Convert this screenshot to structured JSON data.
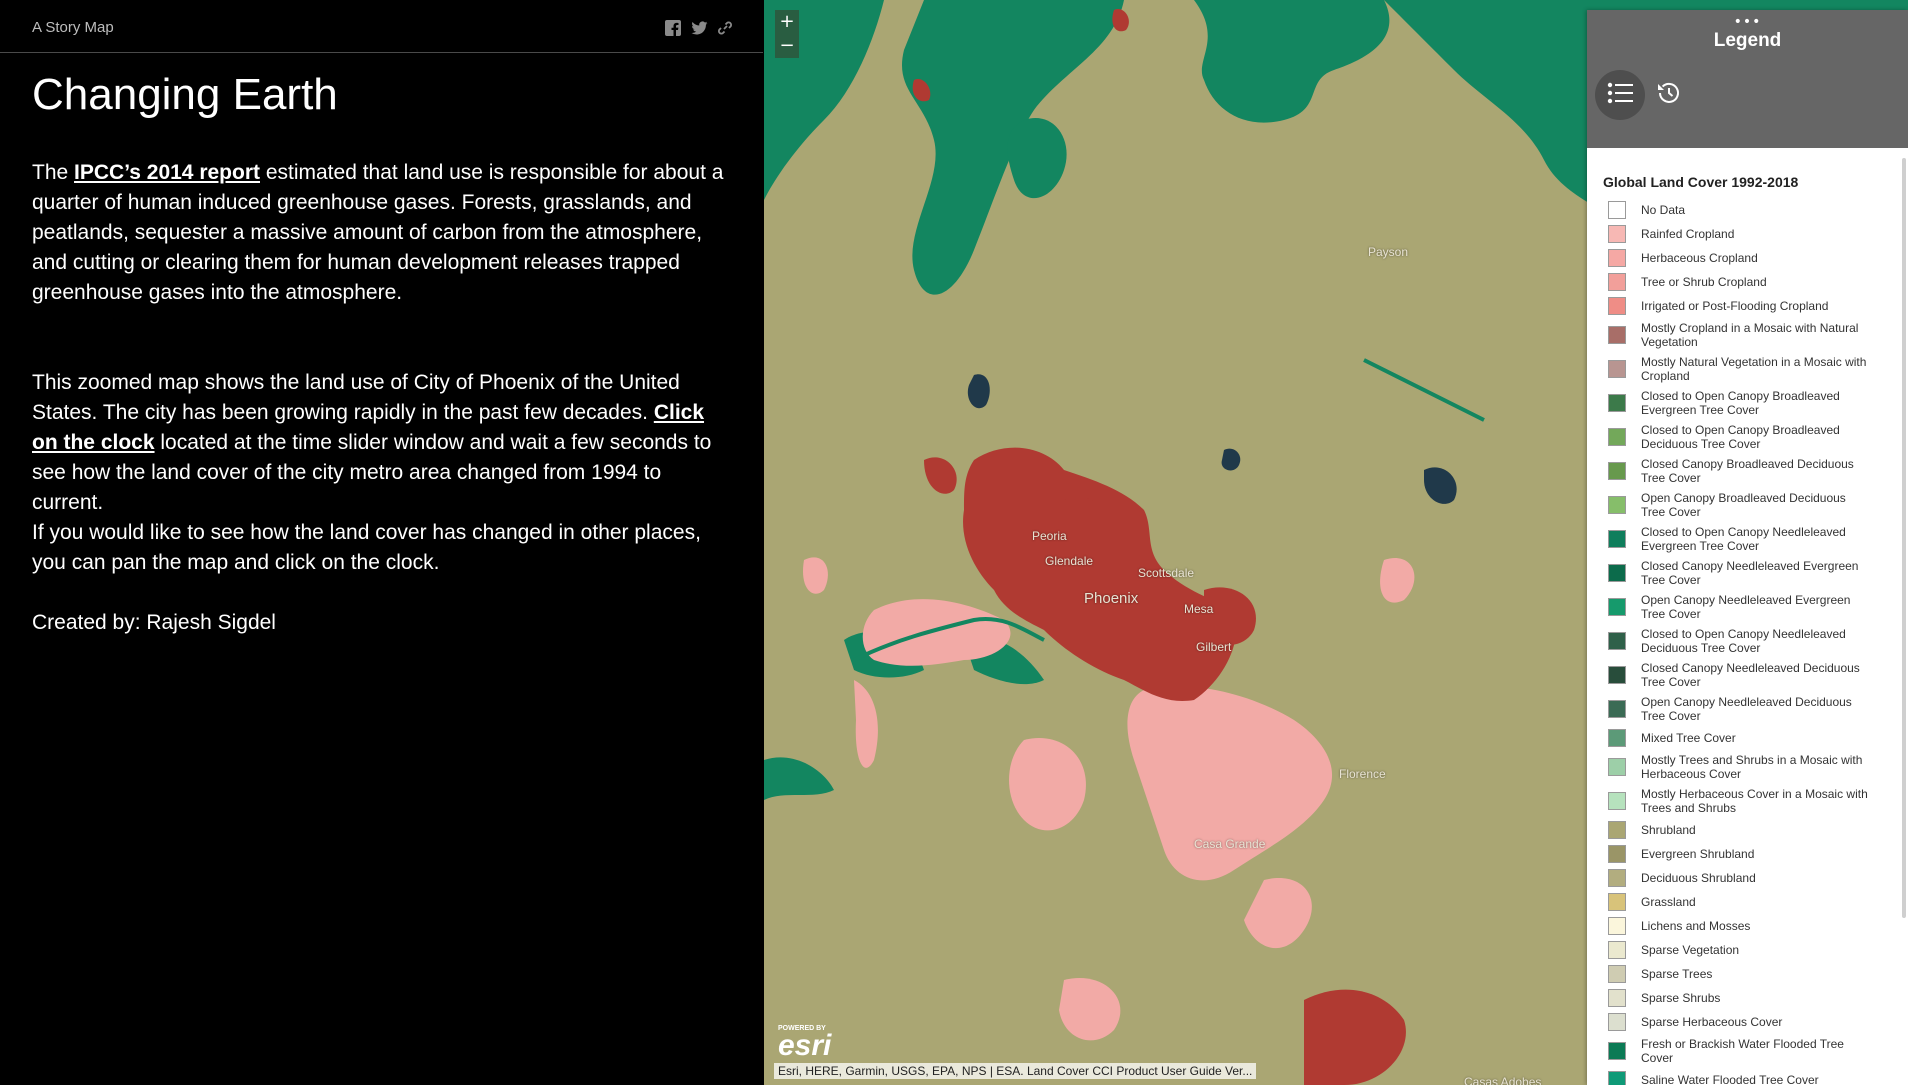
{
  "header": {
    "brand": "A Story Map"
  },
  "share": {
    "icons": [
      "facebook-icon",
      "twitter-icon",
      "link-icon"
    ]
  },
  "story": {
    "title": "Changing Earth",
    "p1_before": "The ",
    "p1_link": "IPCC’s 2014 report",
    "p1_after": " estimated that land use is responsible for about a quarter of human induced greenhouse gases. Forests, grasslands, and peatlands, sequester a massive amount of carbon from the atmosphere, and cutting or clearing them for human development releases trapped greenhouse gases into the atmosphere.",
    "p2_before": "This zoomed map shows the land use of City of Phoenix of the United States. The city has been growing rapidly in the past few decades. ",
    "p2_link": "Click on the clock",
    "p2_after": " located at the time slider window and wait a few seconds to see how the land cover of the city metro area changed from 1994 to current.",
    "p3": "If you would like to see how the land cover has changed in other places, you can pan the map and click on the clock.",
    "p4": "Created by: Rajesh Sigdel"
  },
  "map": {
    "zoom_in": "+",
    "zoom_out": "−",
    "cities": [
      "Peoria",
      "Glendale",
      "Scottsdale",
      "Phoenix",
      "Mesa",
      "Gilbert",
      "Florence",
      "Casa Grande",
      "Payson",
      "Casas Adobes"
    ],
    "attribution": "Esri, HERE, Garmin, USGS, EPA, NPS | ESA. Land Cover CCI Product User Guide Ver...",
    "powered_by": "POWERED BY",
    "esri_logo": "esri",
    "colors": {
      "background": "#aaa673",
      "urban": "#b03a32",
      "cropland": "#f2aaa6",
      "forest": "#138660",
      "water": "#20394a"
    }
  },
  "legend": {
    "dots": "•••",
    "title": "Legend",
    "layer_title": "Global Land Cover 1992-2018",
    "items": [
      {
        "label": "No Data",
        "color": "#ffffff"
      },
      {
        "label": "Rainfed Cropland",
        "color": "#f7b8b4"
      },
      {
        "label": "Herbaceous Cropland",
        "color": "#f5a8a4"
      },
      {
        "label": "Tree or Shrub Cropland",
        "color": "#f29f9a"
      },
      {
        "label": "Irrigated or Post-Flooding Cropland",
        "color": "#ef8d86"
      },
      {
        "label": "Mostly Cropland in a Mosaic with Natural Vegetation",
        "color": "#a86e68"
      },
      {
        "label": "Mostly Natural Vegetation in a Mosaic with Cropland",
        "color": "#b89591"
      },
      {
        "label": "Closed to Open Canopy Broadleaved Evergreen Tree Cover",
        "color": "#3c7a4a"
      },
      {
        "label": "Closed to Open Canopy Broadleaved Deciduous Tree Cover",
        "color": "#73a85a"
      },
      {
        "label": "Closed Canopy Broadleaved Deciduous Tree Cover",
        "color": "#67994d"
      },
      {
        "label": "Open Canopy Broadleaved Deciduous Tree Cover",
        "color": "#86be6a"
      },
      {
        "label": "Closed to Open Canopy Needleleaved Evergreen Tree Cover",
        "color": "#0f7e5c"
      },
      {
        "label": "Closed Canopy Needleleaved Evergreen Tree Cover",
        "color": "#0c6b4b"
      },
      {
        "label": "Open Canopy Needleleaved Evergreen Tree Cover",
        "color": "#169a6c"
      },
      {
        "label": "Closed to Open Canopy Needleleaved Deciduous Tree Cover",
        "color": "#2f6049"
      },
      {
        "label": "Closed Canopy Needleleaved Deciduous Tree Cover",
        "color": "#284d3b"
      },
      {
        "label": "Open Canopy Needleleaved Deciduous Tree Cover",
        "color": "#3b6b55"
      },
      {
        "label": "Mixed Tree Cover",
        "color": "#5c9a78"
      },
      {
        "label": "Mostly Trees and Shrubs in a Mosaic with Herbaceous Cover",
        "color": "#9dcfa8"
      },
      {
        "label": "Mostly Herbaceous Cover in a Mosaic with Trees and Shrubs",
        "color": "#b6e2bd"
      },
      {
        "label": "Shrubland",
        "color": "#aaa673"
      },
      {
        "label": "Evergreen Shrubland",
        "color": "#9a9567"
      },
      {
        "label": "Deciduous Shrubland",
        "color": "#b2ad7f"
      },
      {
        "label": "Grassland",
        "color": "#d8c37a"
      },
      {
        "label": "Lichens and Mosses",
        "color": "#fbf6dc"
      },
      {
        "label": "Sparse Vegetation",
        "color": "#ebe9cf"
      },
      {
        "label": "Sparse Trees",
        "color": "#cfccb2"
      },
      {
        "label": "Sparse Shrubs",
        "color": "#e2e1cc"
      },
      {
        "label": "Sparse Herbaceous Cover",
        "color": "#dcdfcf"
      },
      {
        "label": "Fresh or Brackish Water Flooded Tree Cover",
        "color": "#0b7a55"
      },
      {
        "label": "Saline Water Flooded Tree Cover",
        "color": "#0f9a77"
      }
    ]
  }
}
